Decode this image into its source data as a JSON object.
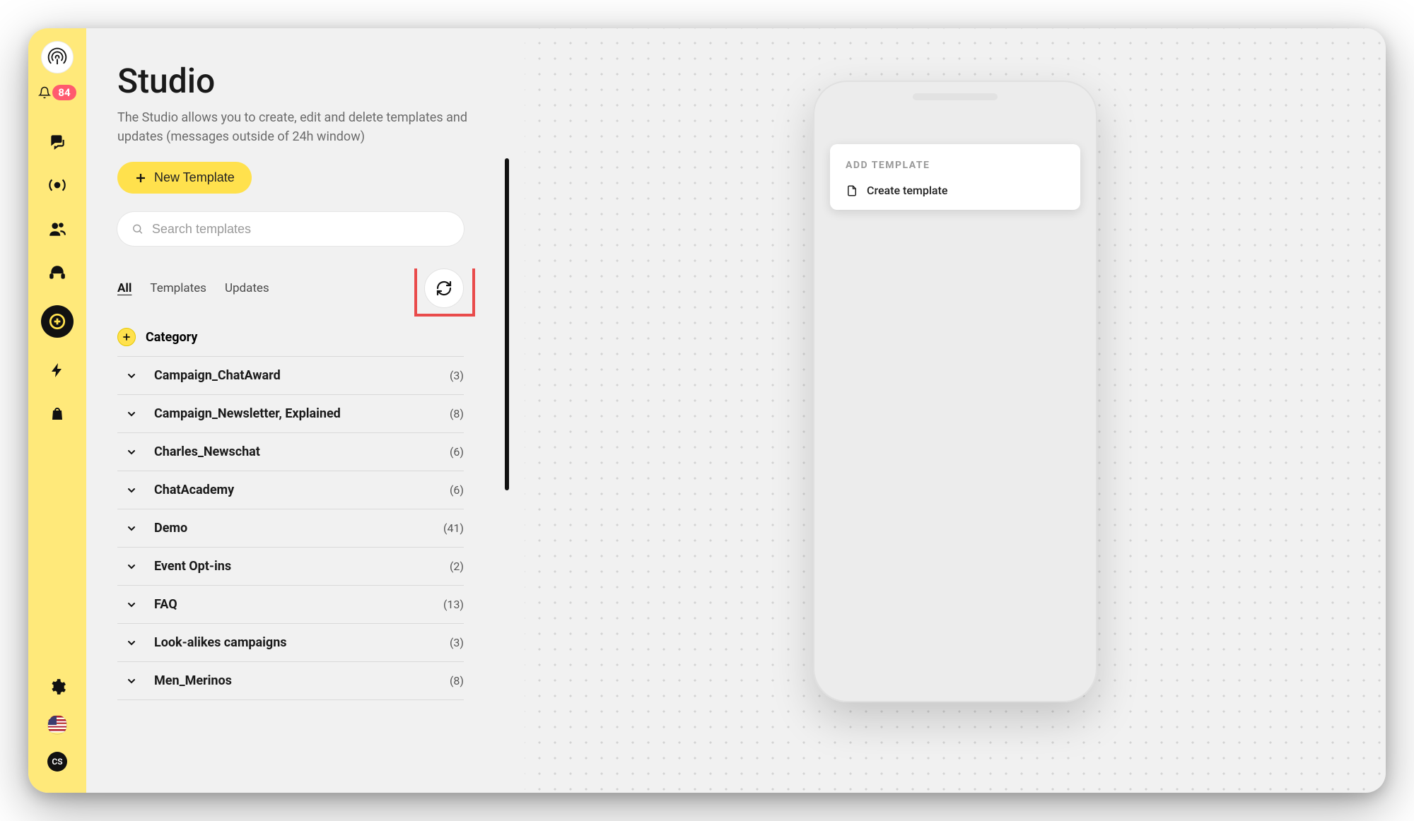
{
  "sidebar": {
    "notifications_count": "84",
    "avatar_initials": "CS"
  },
  "header": {
    "title": "Studio",
    "subtitle": "The Studio allows you to create, edit and delete templates and updates (messages outside of 24h window)",
    "new_template_label": "New Template"
  },
  "search": {
    "placeholder": "Search templates"
  },
  "tabs": {
    "all": "All",
    "templates": "Templates",
    "updates": "Updates"
  },
  "category_header": "Category",
  "categories": [
    {
      "name": "Campaign_ChatAward",
      "count": "(3)"
    },
    {
      "name": "Campaign_Newsletter, Explained",
      "count": "(8)"
    },
    {
      "name": "Charles_Newschat",
      "count": "(6)"
    },
    {
      "name": "ChatAcademy",
      "count": "(6)"
    },
    {
      "name": "Demo",
      "count": "(41)"
    },
    {
      "name": "Event Opt-ins",
      "count": "(2)"
    },
    {
      "name": "FAQ",
      "count": "(13)"
    },
    {
      "name": "Look-alikes campaigns",
      "count": "(3)"
    },
    {
      "name": "Men_Merinos",
      "count": "(8)"
    }
  ],
  "phone_card": {
    "title": "ADD TEMPLATE",
    "action": "Create template"
  }
}
